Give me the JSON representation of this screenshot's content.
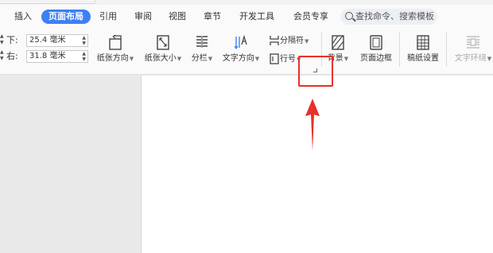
{
  "tabs": [
    {
      "label": "插入"
    },
    {
      "label": "页面布局"
    },
    {
      "label": "引用"
    },
    {
      "label": "审阅"
    },
    {
      "label": "视图"
    },
    {
      "label": "章节"
    },
    {
      "label": "开发工具"
    },
    {
      "label": "会员专享"
    }
  ],
  "search": {
    "placeholder": "查找命令、搜索模板"
  },
  "margins": {
    "bottom": {
      "label": "下:",
      "value": "25.4 毫米"
    },
    "right": {
      "label": "右:",
      "value": "31.8 毫米"
    }
  },
  "tools": {
    "orientation": "纸张方向",
    "size": "纸张大小",
    "columns": "分栏",
    "text_direction": "文字方向",
    "breaks": "分隔符",
    "line_numbers": "行号",
    "background": "背景",
    "page_border": "页面边框",
    "manuscript": "稿纸设置",
    "text_wrap": "文字环绕"
  },
  "colors": {
    "accent": "#3d7ff5",
    "highlight": "#e8312a"
  }
}
